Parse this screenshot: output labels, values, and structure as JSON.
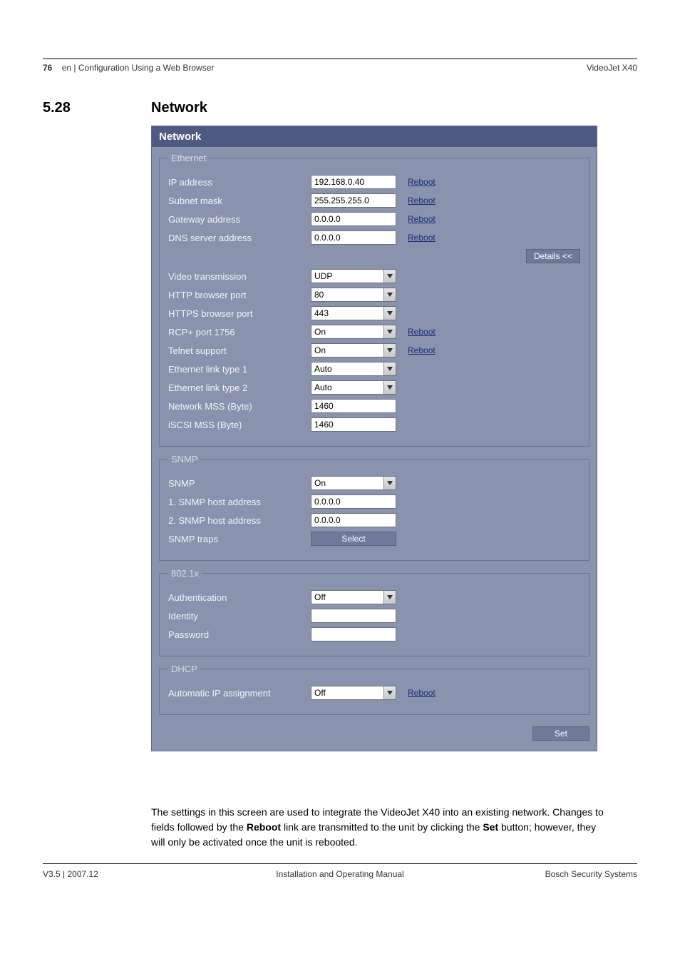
{
  "header": {
    "page_number": "76",
    "breadcrumb": "en | Configuration Using a Web Browser",
    "product": "VideoJet X40"
  },
  "section": {
    "number": "5.28",
    "title": "Network"
  },
  "panel": {
    "title": "Network",
    "details_button": "Details <<",
    "set_button": "Set",
    "reboot_label": "Reboot",
    "ethernet": {
      "legend": "Ethernet",
      "ip_address": {
        "label": "IP address",
        "value": "192.168.0.40",
        "reboot": true
      },
      "subnet_mask": {
        "label": "Subnet mask",
        "value": "255.255.255.0",
        "reboot": true
      },
      "gateway_address": {
        "label": "Gateway address",
        "value": "0.0.0.0",
        "reboot": true
      },
      "dns_server_address": {
        "label": "DNS server address",
        "value": "0.0.0.0",
        "reboot": true
      },
      "video_transmission": {
        "label": "Video transmission",
        "value": "UDP"
      },
      "http_port": {
        "label": "HTTP browser port",
        "value": "80"
      },
      "https_port": {
        "label": "HTTPS browser port",
        "value": "443"
      },
      "rcp_port": {
        "label": "RCP+ port 1756",
        "value": "On",
        "reboot": true
      },
      "telnet": {
        "label": "Telnet support",
        "value": "On",
        "reboot": true
      },
      "link1": {
        "label": "Ethernet link type 1",
        "value": "Auto"
      },
      "link2": {
        "label": "Ethernet link type 2",
        "value": "Auto"
      },
      "mss": {
        "label": "Network MSS (Byte)",
        "value": "1460"
      },
      "iscsi_mss": {
        "label": "iSCSI MSS (Byte)",
        "value": "1460"
      }
    },
    "snmp": {
      "legend": "SNMP",
      "snmp": {
        "label": "SNMP",
        "value": "On"
      },
      "host1": {
        "label": "1. SNMP host address",
        "value": "0.0.0.0"
      },
      "host2": {
        "label": "2. SNMP host address",
        "value": "0.0.0.0"
      },
      "traps": {
        "label": "SNMP traps",
        "button": "Select"
      }
    },
    "dot1x": {
      "legend": "802.1x",
      "auth": {
        "label": "Authentication",
        "value": "Off"
      },
      "identity": {
        "label": "Identity",
        "value": ""
      },
      "password": {
        "label": "Password",
        "value": ""
      }
    },
    "dhcp": {
      "legend": "DHCP",
      "auto_ip": {
        "label": "Automatic IP assignment",
        "value": "Off",
        "reboot": true
      }
    }
  },
  "body_text": {
    "part1": "The settings in this screen are used to integrate the VideoJet X40 into an existing network. Changes to fields followed by the ",
    "bold1": "Reboot",
    "part2": " link are transmitted to the unit by clicking the ",
    "bold2": "Set",
    "part3": " button; however, they will only be activated once the unit is rebooted."
  },
  "footer": {
    "left": "V3.5 | 2007.12",
    "center": "Installation and Operating Manual",
    "right": "Bosch Security Systems"
  }
}
